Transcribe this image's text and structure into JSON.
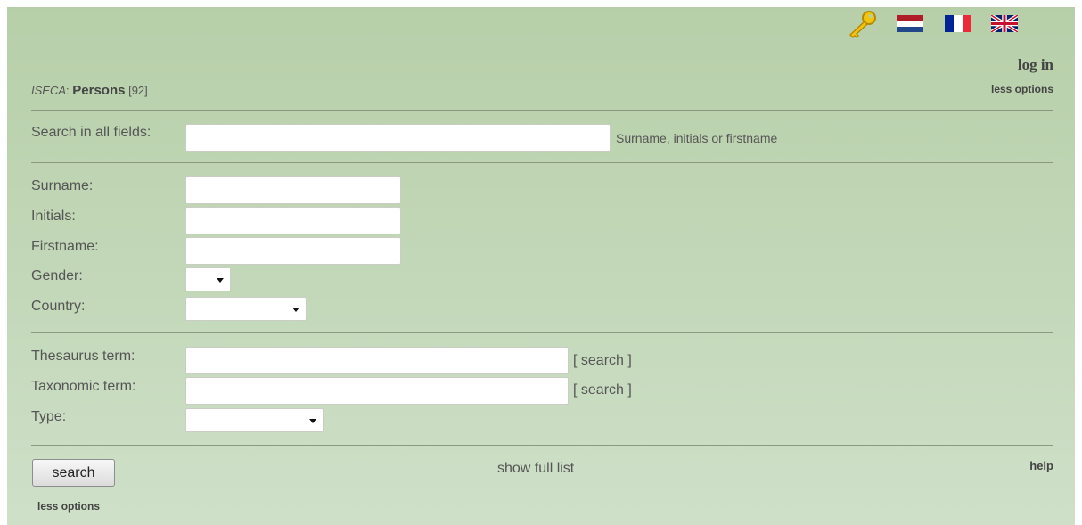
{
  "header": {
    "login": "log in",
    "less_options_top": "less options",
    "breadcrumb": {
      "app": "ISECA",
      "separator": ":",
      "section": "Persons",
      "count": "[92]"
    },
    "languages": [
      "nl",
      "fr",
      "en"
    ]
  },
  "search_all": {
    "label": "Search in all fields:",
    "value": "",
    "hint": "Surname, initials or firstname"
  },
  "fields": {
    "surname": {
      "label": "Surname:",
      "value": ""
    },
    "initials": {
      "label": "Initials:",
      "value": ""
    },
    "firstname": {
      "label": "Firstname:",
      "value": ""
    },
    "gender": {
      "label": "Gender:",
      "selected": ""
    },
    "country": {
      "label": "Country:",
      "selected": ""
    }
  },
  "terms": {
    "thesaurus": {
      "label": "Thesaurus term:",
      "value": "",
      "search_link": "[ search ]"
    },
    "taxonomic": {
      "label": "Taxonomic term:",
      "value": "",
      "search_link": "[ search ]"
    },
    "type": {
      "label": "Type:",
      "selected": ""
    }
  },
  "footer": {
    "search_button": "search",
    "show_full_list": "show full list",
    "help": "help",
    "less_options_bottom": "less options"
  },
  "icons": {
    "login": "key-icon",
    "flags": [
      "flag-nl-icon",
      "flag-fr-icon",
      "flag-uk-icon"
    ]
  },
  "colors": {
    "panel_top": "#b7cfa9",
    "panel_bottom": "#cfe0c9",
    "divider": "#8a9a80",
    "key": "#e3b400"
  }
}
